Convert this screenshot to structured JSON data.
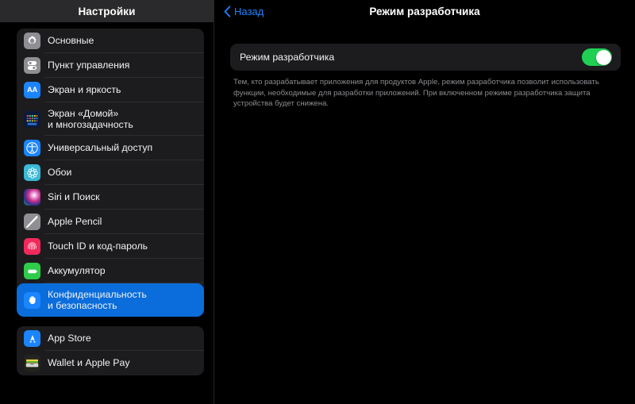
{
  "sidebar": {
    "title": "Настройки",
    "groups": [
      {
        "items": [
          {
            "label": "Основные",
            "icon": "gear-icon",
            "selected": false
          },
          {
            "label": "Пункт управления",
            "icon": "control-center-icon",
            "selected": false
          },
          {
            "label": "Экран и яркость",
            "icon": "display-brightness-icon",
            "selected": false
          },
          {
            "label": "Экран «Домой»\nи многозадачность",
            "icon": "home-screen-icon",
            "selected": false
          },
          {
            "label": "Универсальный доступ",
            "icon": "accessibility-icon",
            "selected": false
          },
          {
            "label": "Обои",
            "icon": "wallpaper-icon",
            "selected": false
          },
          {
            "label": "Siri и Поиск",
            "icon": "siri-icon",
            "selected": false
          },
          {
            "label": "Apple Pencil",
            "icon": "apple-pencil-icon",
            "selected": false
          },
          {
            "label": "Touch ID и код-пароль",
            "icon": "touch-id-icon",
            "selected": false
          },
          {
            "label": "Аккумулятор",
            "icon": "battery-icon",
            "selected": false
          },
          {
            "label": "Конфиденциальность\nи безопасность",
            "icon": "privacy-hand-icon",
            "selected": true
          }
        ]
      },
      {
        "items": [
          {
            "label": "App Store",
            "icon": "app-store-icon",
            "selected": false
          },
          {
            "label": "Wallet и Apple Pay",
            "icon": "wallet-icon",
            "selected": false
          }
        ]
      }
    ]
  },
  "detail": {
    "back_label": "Назад",
    "back_icon": "chevron-left-icon",
    "title": "Режим разработчика",
    "toggle_label": "Режим разработчика",
    "toggle_state": "on",
    "description": "Тем, кто разрабатывает приложения для продуктов Apple, режим разработчика позволит использовать функции, необходимые для разработки приложений. При включенном режиме разработчика защита устройства будет снижена."
  },
  "colors": {
    "accent_blue": "#1b84ff",
    "selected_row": "#0a6ddb",
    "toggle_on_green": "#1fd053",
    "card_background": "#1c1c1e",
    "page_background": "#000000"
  }
}
